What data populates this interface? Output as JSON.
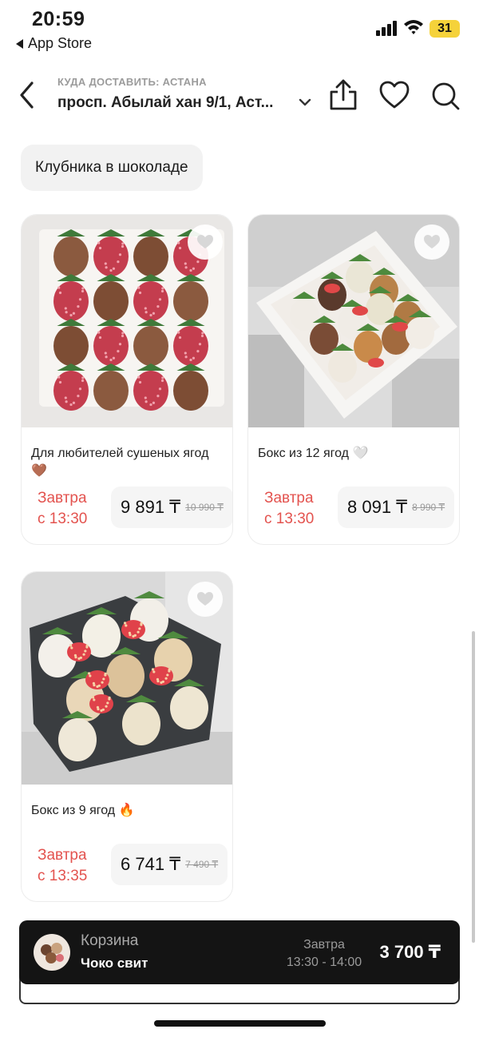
{
  "status_bar": {
    "time": "20:59",
    "back_app": "App Store",
    "battery": "31"
  },
  "header": {
    "caption": "КУДА ДОСТАВИТЬ: АСТАНА",
    "address": "просп. Абылай хан 9/1, Аст..."
  },
  "category": {
    "label": "Клубника в шоколаде"
  },
  "products": [
    {
      "title": "Для любителей сушеных ягод 🤎",
      "delivery_line1": "Завтра",
      "delivery_line2": "с 13:30",
      "price": "9 891 ₸",
      "old_price": "10 990 ₸"
    },
    {
      "title": "Бокс из 12 ягод 🤍",
      "delivery_line1": "Завтра",
      "delivery_line2": "с 13:30",
      "price": "8 091 ₸",
      "old_price": "8 990 ₸"
    },
    {
      "title": "Бокс из 9 ягод 🔥",
      "delivery_line1": "Завтра",
      "delivery_line2": "с 13:35",
      "price": "6 741 ₸",
      "old_price": "7 490 ₸"
    }
  ],
  "cart": {
    "label": "Корзина",
    "store": "Чоко свит",
    "when_line1": "Завтра",
    "when_line2": "13:30 - 14:00",
    "total": "3 700 ₸"
  },
  "colors": {
    "accent_red": "#e3534f",
    "cart_bg": "#141414",
    "chip_bg": "#f2f2f2",
    "battery": "#f5d23a"
  },
  "icons": [
    "back-arrow-icon",
    "share-icon",
    "heart-icon",
    "search-icon",
    "chevron-down-icon",
    "favorite-heart-icon"
  ]
}
